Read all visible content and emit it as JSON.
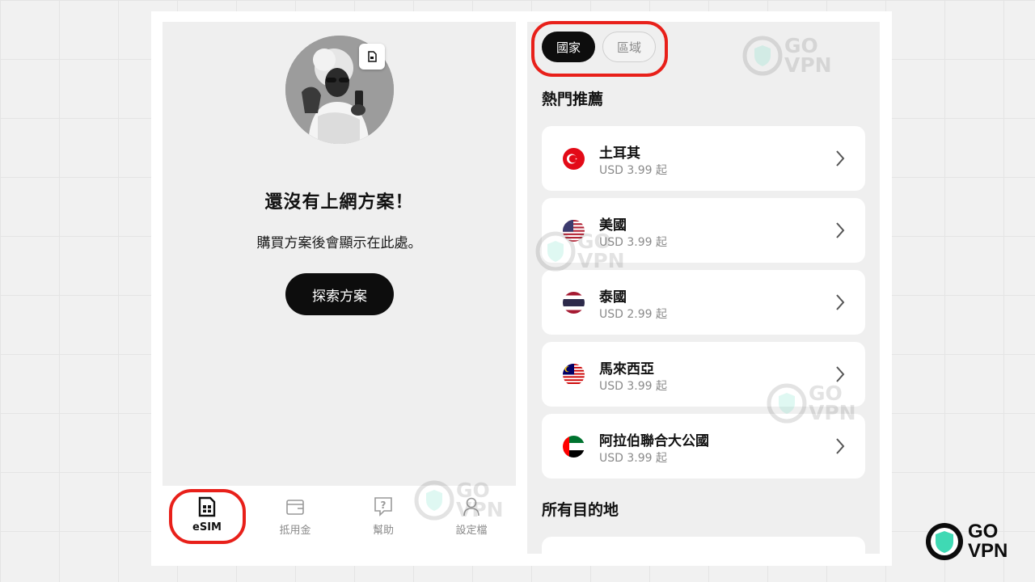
{
  "left_screen": {
    "empty_title": "還沒有上網方案！",
    "empty_subtitle": "購買方案後會顯示在此處。",
    "explore_button": "探索方案",
    "bottom_nav": [
      {
        "label": "eSIM",
        "icon": "sim-card-icon",
        "active": true
      },
      {
        "label": "抵用金",
        "icon": "wallet-icon",
        "active": false
      },
      {
        "label": "幫助",
        "icon": "help-icon",
        "active": false
      },
      {
        "label": "設定檔",
        "icon": "profile-icon",
        "active": false
      }
    ]
  },
  "right_screen": {
    "tabs": [
      {
        "label": "國家",
        "selected": true
      },
      {
        "label": "區域",
        "selected": false
      }
    ],
    "popular_heading": "熱門推薦",
    "destinations": [
      {
        "name": "土耳其",
        "price": "USD 3.99 起",
        "flag": "turkey"
      },
      {
        "name": "美國",
        "price": "USD 3.99 起",
        "flag": "usa"
      },
      {
        "name": "泰國",
        "price": "USD 2.99 起",
        "flag": "thailand"
      },
      {
        "name": "馬來西亞",
        "price": "USD 3.99 起",
        "flag": "malaysia"
      },
      {
        "name": "阿拉伯聯合大公國",
        "price": "USD 3.99 起",
        "flag": "uae"
      }
    ],
    "all_heading": "所有目的地"
  },
  "watermark": {
    "line1": "GO",
    "line2": "VPN"
  },
  "colors": {
    "highlight": "#e8201a",
    "primary": "#0d0d0d",
    "shield": "#3fd9b4"
  }
}
